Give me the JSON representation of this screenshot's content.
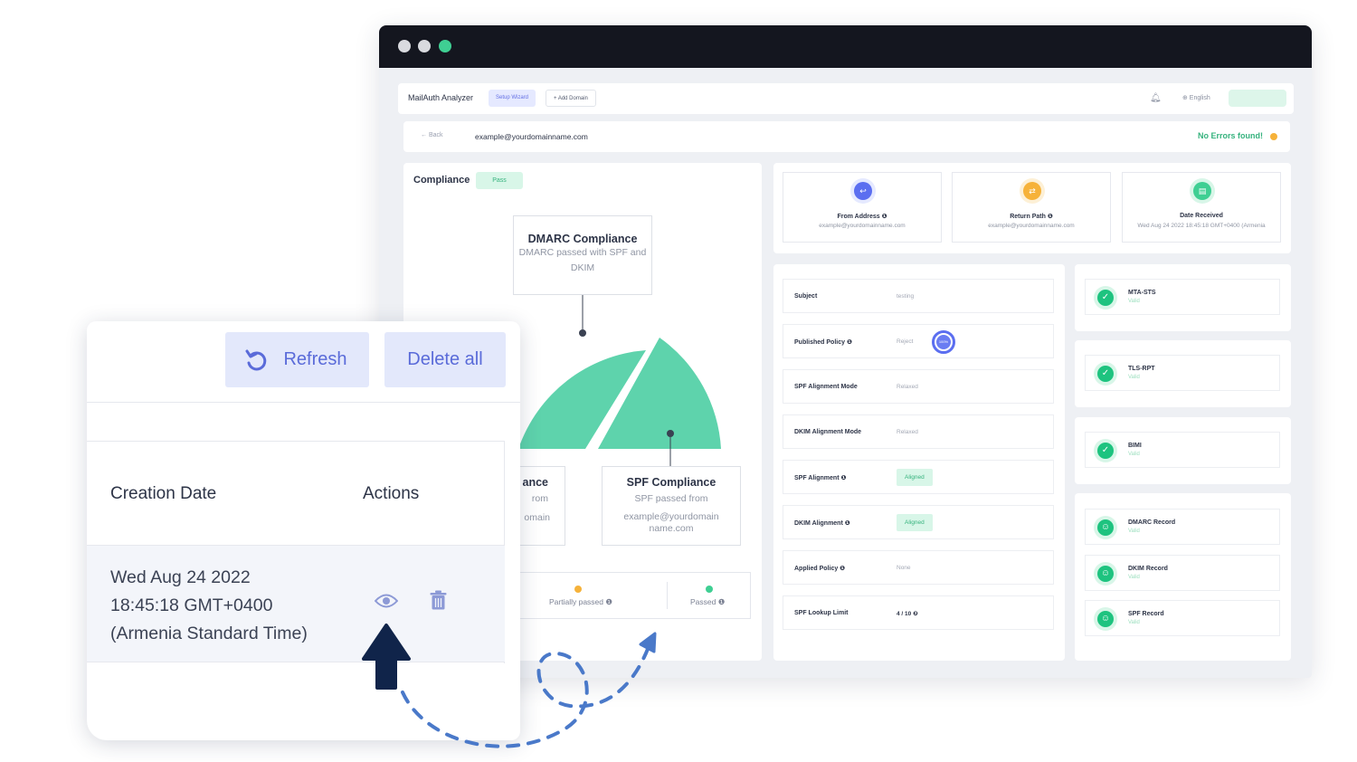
{
  "app": {
    "brand": "MailAuth Analyzer",
    "tab_setup": "Setup Wizard",
    "tab_add": "+ Add Domain",
    "bell_icon": "bell-icon",
    "language": "⊕ English"
  },
  "subbar": {
    "back": "←  Back",
    "email": "example@yourdomainname.com",
    "status": "No Errors found!",
    "status_color": "#36b37e",
    "status_dot_color": "#f6b23a"
  },
  "compliance": {
    "title": "Compliance",
    "badge": "Pass",
    "dmarc_title": "DMARC Compliance",
    "dmarc_desc": "DMARC passed with SPF and DKIM",
    "dkim_title": "ance",
    "dkim_desc_1": "rom",
    "dkim_desc_2": "omain",
    "spf_title": "SPF Compliance",
    "spf_desc_1": "SPF passed from",
    "spf_desc_2": "example@yourdomain",
    "spf_desc_3": "name.com",
    "legend_partial": "Partially passed ❶",
    "legend_passed": "Passed ❶",
    "accent": "#5ed3ac"
  },
  "info_cards": [
    {
      "label": "From Address ❶",
      "value": "example@yourdomainname.com",
      "icon": "arrow-icon",
      "color": "#5b6ef0"
    },
    {
      "label": "Return Path ❶",
      "value": "example@yourdomainname.com",
      "icon": "path-icon",
      "color": "#f6b23a"
    },
    {
      "label": "Date Received",
      "value": "Wed Aug 24 2022 18:45:18 GMT+0400 (Armenia",
      "icon": "calendar-icon",
      "color": "#3fcf93"
    }
  ],
  "details": [
    {
      "label": "Subject",
      "value": "testing"
    },
    {
      "label": "Published Policy ❶",
      "value": "Reject",
      "ring": "100%"
    },
    {
      "label": "SPF Alignment Mode",
      "value": "Relaxed"
    },
    {
      "label": "DKIM Alignment Mode",
      "value": "Relaxed"
    },
    {
      "label": "SPF Alignment ❶",
      "badge": "Aligned"
    },
    {
      "label": "DKIM Alignment ❶",
      "badge": "Aligned"
    },
    {
      "label": "Applied Policy ❶",
      "value": "None"
    },
    {
      "label": "SPF Lookup Limit",
      "value": "4 / 10 ❷"
    }
  ],
  "side": [
    {
      "name": "MTA-STS",
      "status": "Valid"
    },
    {
      "name": "TLS-RPT",
      "status": "Valid"
    },
    {
      "name": "BIMI",
      "status": "Valid"
    },
    {
      "name": "DMARC Record",
      "status": "Valid"
    },
    {
      "name": "DKIM Record",
      "status": "Valid"
    },
    {
      "name": "SPF Record",
      "status": "Valid"
    }
  ],
  "card": {
    "refresh": "Refresh",
    "delete_all": "Delete all",
    "col_date": "Creation Date",
    "col_actions": "Actions",
    "row_date_1": "Wed Aug 24 2022",
    "row_date_2": "18:45:18 GMT+0400",
    "row_date_3": "(Armenia Standard Time)",
    "button_color": "#e3e8fb",
    "button_text_color": "#5a6bd9"
  }
}
